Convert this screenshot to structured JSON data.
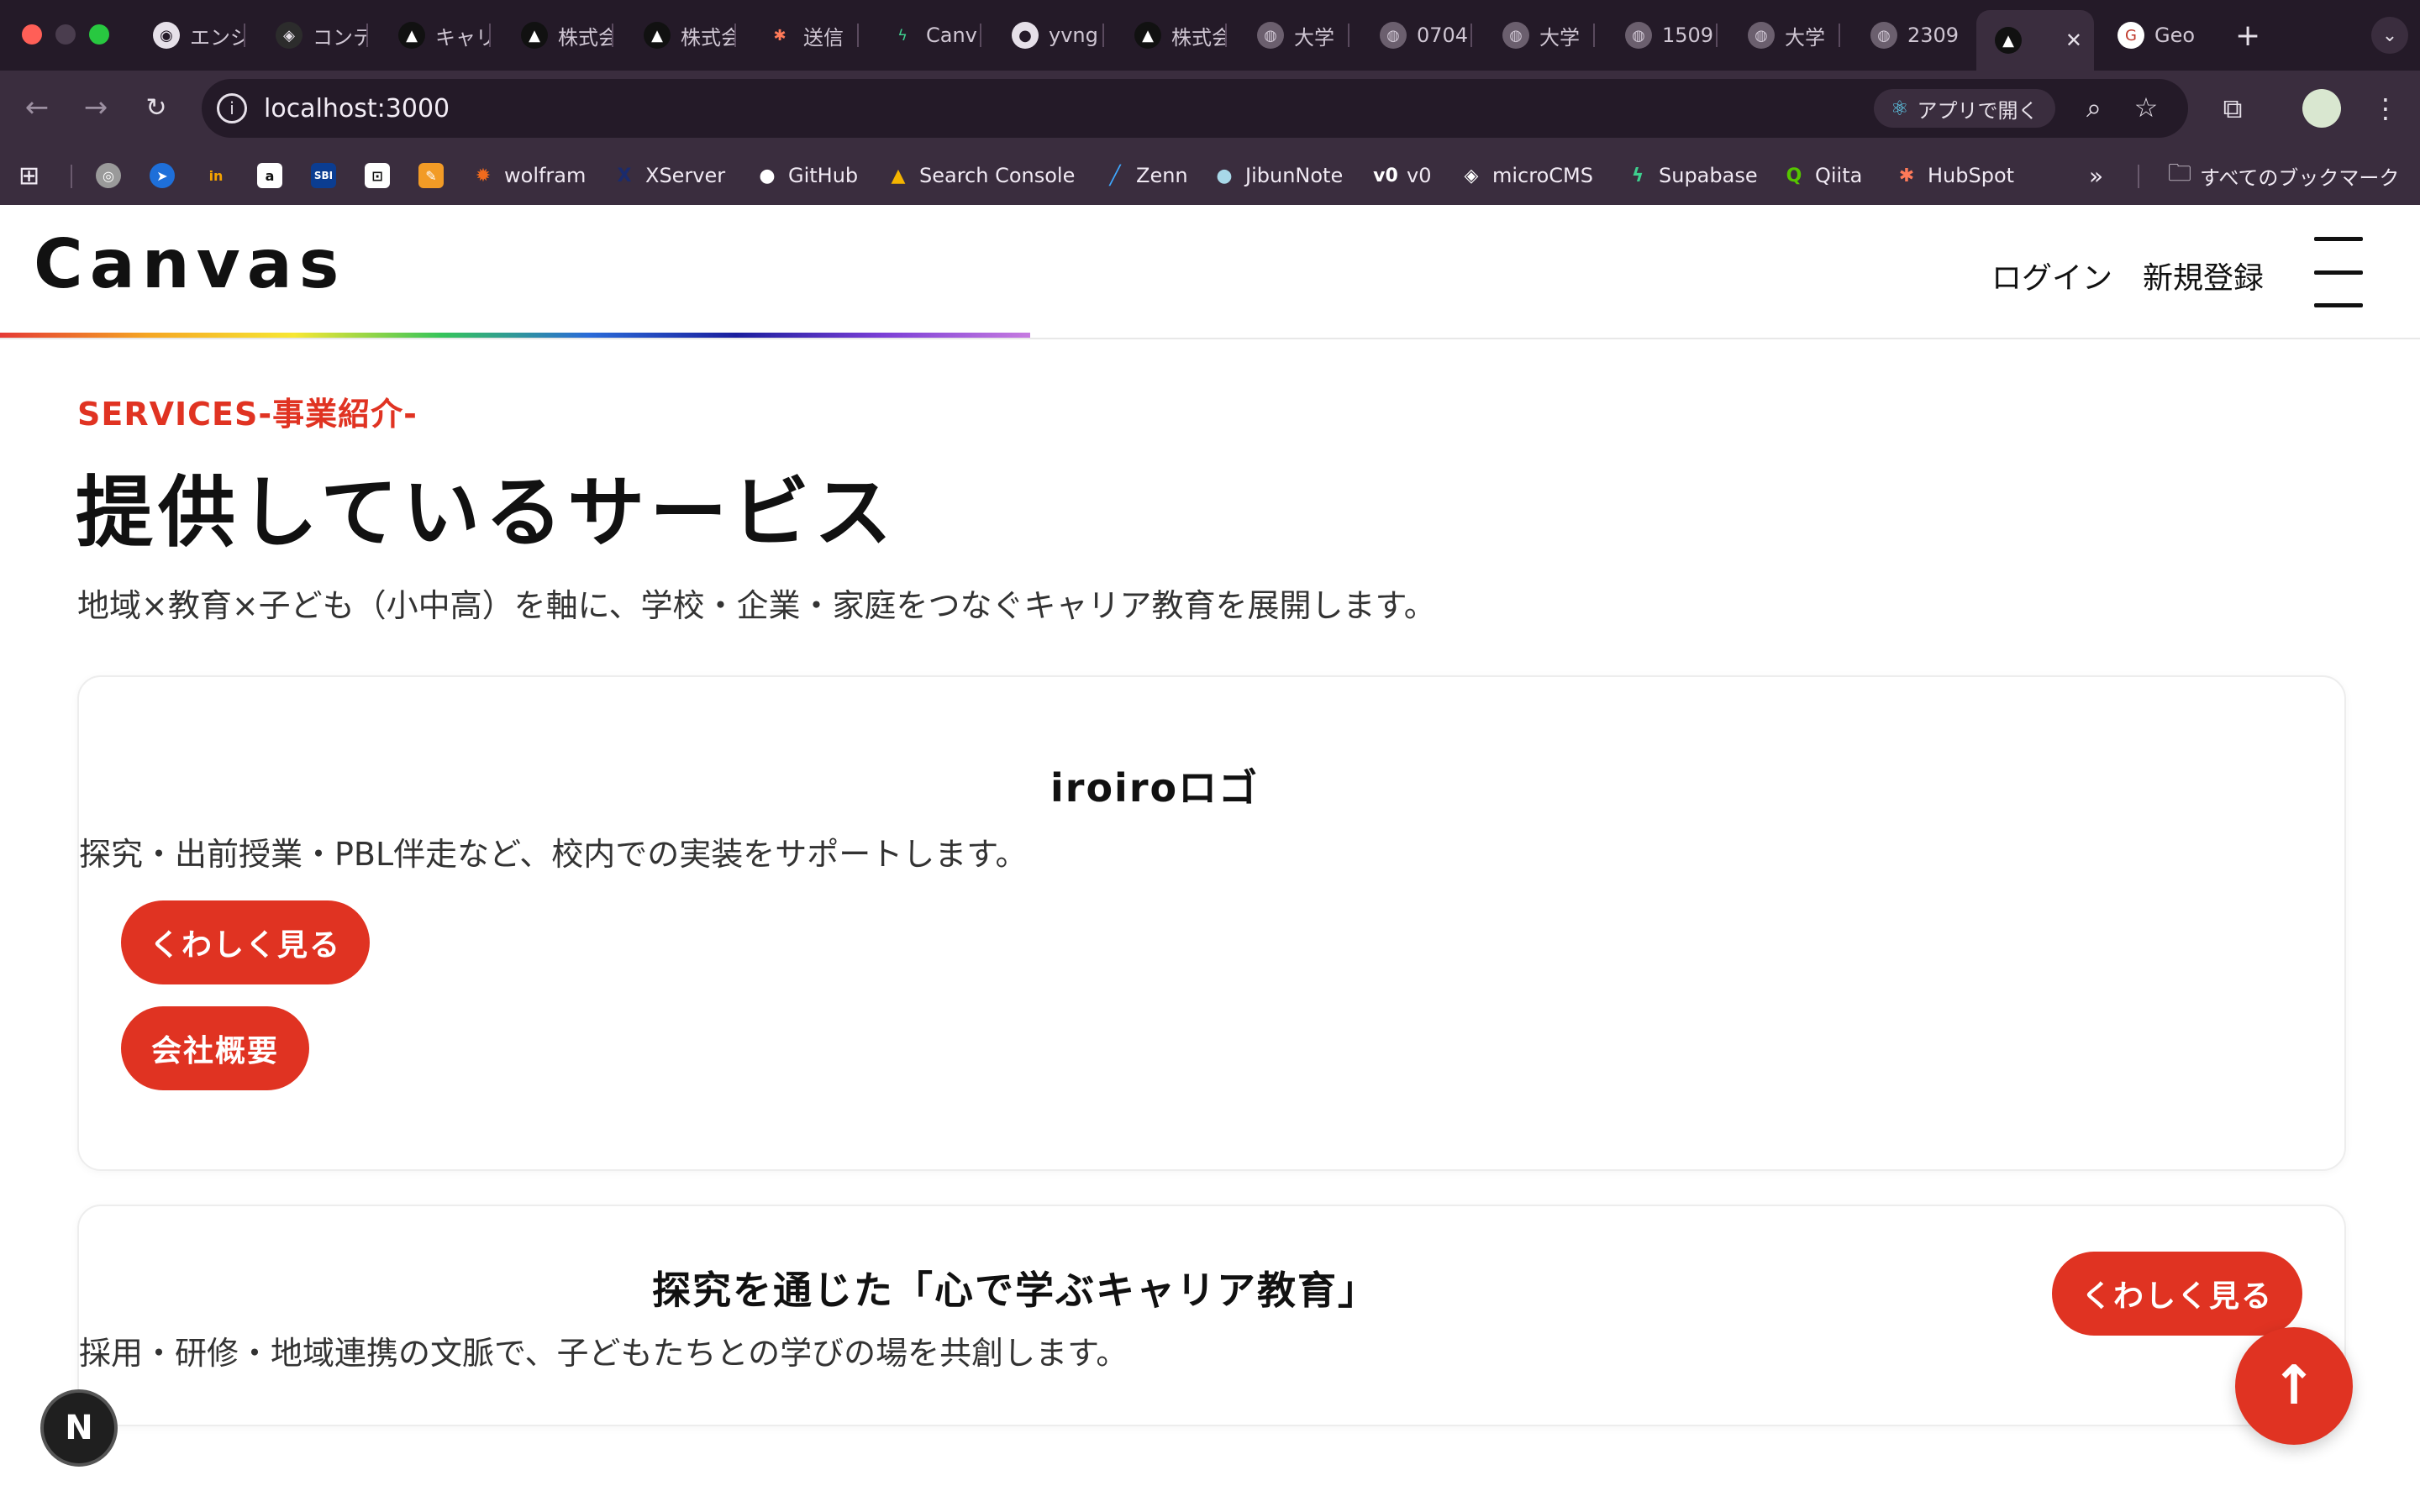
{
  "browser": {
    "tabs": [
      {
        "label": "エンジ",
        "icon": "ring-icon"
      },
      {
        "label": "コンテ",
        "icon": "microcms-icon"
      },
      {
        "label": "キャリ",
        "icon": "triangle-icon"
      },
      {
        "label": "株式会",
        "icon": "triangle-icon"
      },
      {
        "label": "株式会",
        "icon": "triangle-icon"
      },
      {
        "label": "送信",
        "icon": "hubspot-icon"
      },
      {
        "label": "Canv",
        "icon": "supabase-icon"
      },
      {
        "label": "yvng",
        "icon": "github-icon"
      },
      {
        "label": "株式会",
        "icon": "triangle-icon"
      },
      {
        "label": "大学",
        "icon": "globe-icon"
      },
      {
        "label": "0704",
        "icon": "globe-icon"
      },
      {
        "label": "大学",
        "icon": "globe-icon"
      },
      {
        "label": "1509",
        "icon": "globe-icon"
      },
      {
        "label": "大学",
        "icon": "globe-icon"
      },
      {
        "label": "2309",
        "icon": "globe-icon"
      },
      {
        "label": "",
        "icon": "triangle-icon"
      },
      {
        "label": "Geo",
        "icon": "g-icon"
      }
    ],
    "url": "localhost:3000",
    "open_app_label": "アプリで開く",
    "bookmarks": [
      {
        "label": "wolfram",
        "color": "#f06a1d"
      },
      {
        "label": "XServer",
        "color": "#1a2b6d"
      },
      {
        "label": "GitHub",
        "color": "#ffffff"
      },
      {
        "label": "Search Console",
        "color": "#f4b400"
      },
      {
        "label": "Zenn",
        "color": "#3ea8ff"
      },
      {
        "label": "JibunNote",
        "color": "#a8d8e8"
      },
      {
        "label": "v0",
        "color": "#ffffff"
      },
      {
        "label": "microCMS",
        "color": "#ffffff"
      },
      {
        "label": "Supabase",
        "color": "#3ecf8e"
      },
      {
        "label": "Qiita",
        "color": "#55c500"
      },
      {
        "label": "HubSpot",
        "color": "#ff7a59"
      }
    ],
    "all_bookmarks_label": "すべてのブックマーク"
  },
  "site": {
    "logo": "Canvas",
    "login": "ログイン",
    "signup": "新規登録",
    "accent": "#e03322"
  },
  "services": {
    "eyebrow": "SERVICES-事業紹介-",
    "title": "提供しているサービス",
    "lead": "地域×教育×子ども（小中高）を軸に、学校・企業・家庭をつなぐキャリア教育を展開します。",
    "cards": [
      {
        "title": "iroiroロゴ",
        "text": "探究・出前授業・PBL伴走など、校内での実装をサポートします。",
        "more": "くわしく見る",
        "secondary": "会社概要"
      },
      {
        "title": "探究を通じた「心で学ぶキャリア教育」",
        "text": "採用・研修・地域連携の文脈で、子どもたちとの学びの場を共創します。",
        "more": "くわしく見る"
      }
    ]
  },
  "badge": "N"
}
